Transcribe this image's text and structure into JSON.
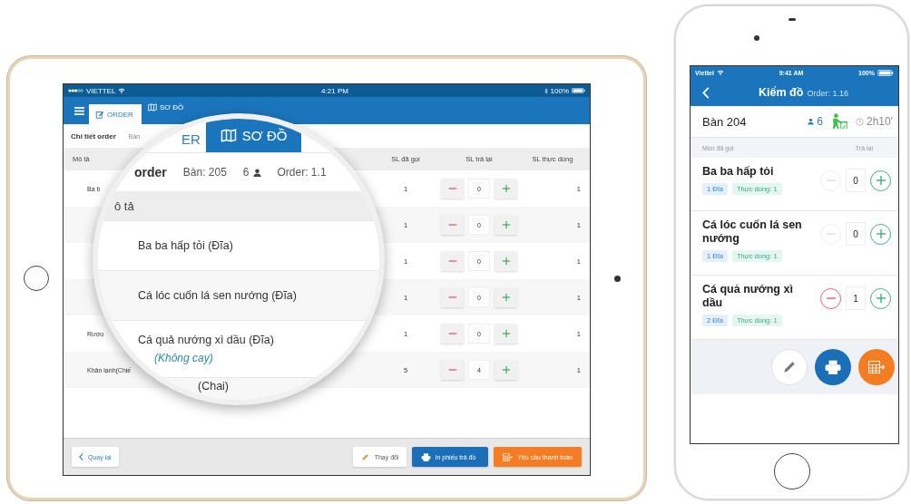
{
  "tablet": {
    "status_bar": {
      "carrier": "VIETTEL",
      "time": "4:21 PM",
      "battery": "100%"
    },
    "tabs": [
      {
        "label": "ORDER",
        "selected": true
      },
      {
        "label": "SƠ ĐỒ",
        "selected": false
      }
    ],
    "breadcrumb": "Chi tiết order",
    "breadcrumb_fragment": "Bàn",
    "table": {
      "columns": [
        "Mô tả",
        "SL đã gọi",
        "SL trả lại",
        "SL thực dùng"
      ],
      "rows": [
        {
          "description": "Ba b",
          "ordered": "1",
          "returned": "0",
          "used": "1"
        },
        {
          "ordered": "1",
          "returned": "0",
          "used": "1"
        },
        {
          "ordered": "1",
          "returned": "0",
          "used": "1"
        },
        {
          "ordered": "1",
          "returned": "0",
          "used": "1"
        },
        {
          "description": "Rượu",
          "ordered": "1",
          "returned": "0",
          "used": "1"
        },
        {
          "description": "Khăn lạnh(Chiế",
          "ordered": "5",
          "returned": "4",
          "used": "1"
        }
      ]
    },
    "footer": {
      "back": "Quay lại",
      "buttons": [
        {
          "label": "Thay đổi",
          "kind": "edit"
        },
        {
          "label": "In phiếu trả đồ",
          "kind": "print"
        },
        {
          "label": "Yêu cầu thanh toán",
          "kind": "payment"
        }
      ]
    }
  },
  "magnifier": {
    "tabs": [
      {
        "label": "ER",
        "selected": true
      },
      {
        "label": "SƠ ĐỒ",
        "selected": false
      }
    ],
    "title": "order",
    "table_label": "Bàn: 205",
    "guests": "6",
    "order_label": "Order: 1.1",
    "column_header": "ô tả",
    "items": [
      {
        "name": "Ba ba hấp tỏi (Đĩa)"
      },
      {
        "name": "Cá lóc cuốn lá sen nướng (Đĩa)"
      },
      {
        "name": "Cá quả nướng xì dầu (Đĩa)",
        "note": "(Không cay)"
      },
      {
        "name": "(Chai)"
      }
    ]
  },
  "phone": {
    "status_bar": {
      "carrier": "Viettel",
      "time": "9:41 AM",
      "battery": "100%"
    },
    "title": "Kiểm đồ",
    "order_label": "Order: 1.16",
    "table": "Bàn 204",
    "guests": "6",
    "duration": "2h10'",
    "columns": [
      "Món đã gọi",
      "Trả lại"
    ],
    "items": [
      {
        "name": "Ba ba hấp tỏi",
        "quantity": "1 Đĩa",
        "used": "Thực dùng: 1",
        "returned": "0",
        "decrease_disabled": true
      },
      {
        "name": "Cá lóc cuốn lá sen nướng",
        "quantity": "1 Đĩa",
        "used": "Thực dùng: 1",
        "returned": "0",
        "decrease_disabled": true
      },
      {
        "name": "Cá quả nướng xì dầu",
        "quantity": "2 Đĩa",
        "used": "Thực dùng: 1",
        "returned": "1",
        "decrease_disabled": false
      }
    ],
    "actions": [
      {
        "kind": "edit"
      },
      {
        "kind": "print"
      },
      {
        "kind": "payment"
      }
    ]
  }
}
